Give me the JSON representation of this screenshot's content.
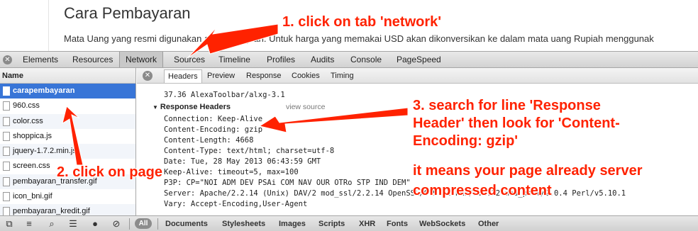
{
  "page": {
    "title": "Cara Pembayaran",
    "paragraph": "Mata Uang yang resmi digunakan adalah Rupiah. Untuk harga yang memakai USD akan dikonversikan ke dalam mata uang Rupiah menggunak"
  },
  "devtools": {
    "tabs": [
      "Elements",
      "Resources",
      "Network",
      "Sources",
      "Timeline",
      "Profiles",
      "Audits",
      "Console",
      "PageSpeed"
    ],
    "active_tab": "Network",
    "left_header": "Name",
    "files": [
      "carapembayaran",
      "960.css",
      "color.css",
      "shoppica.js",
      "jquery-1.7.2.min.js",
      "screen.css",
      "pembayaran_transfer.gif",
      "icon_bni.gif",
      "pembayaran_kredit.gif"
    ],
    "selected_file": "carapembayaran",
    "subtabs": [
      "Headers",
      "Preview",
      "Response",
      "Cookies",
      "Timing"
    ],
    "active_subtab": "Headers",
    "top_line": "37.36 AlexaToolbar/alxg-3.1",
    "response_headers_label": "Response Headers",
    "view_source": "view source",
    "headers": [
      "Connection: Keep-Alive",
      "Content-Encoding: gzip",
      "Content-Length: 4668",
      "Content-Type: text/html; charset=utf-8",
      "Date: Tue, 28 May 2013 06:43:59 GMT",
      "Keep-Alive: timeout=5, max=100",
      "P3P: CP=\"NOI ADM DEV PSAi COM NAV OUR OTRo STP IND DEM\"",
      "Server: Apache/2.2.14 (Unix) DAV/2 mod_ssl/2.2.14 OpenSSL/0.9.8l PHP/5.2.12 mod_perl/2.0.4 Perl/v5.10.1",
      "Vary: Accept-Encoding,User-Agent"
    ],
    "filters": [
      "All",
      "Documents",
      "Stylesheets",
      "Images",
      "Scripts",
      "XHR",
      "Fonts",
      "WebSockets",
      "Other"
    ]
  },
  "annotations": {
    "step1": "1. click on tab 'network'",
    "step2": "2. click on page",
    "step3": [
      "3. search for line 'Response",
      "Header' then look for 'Content-",
      "Encoding: gzip'",
      "it means your page already server",
      "compressed content"
    ],
    "color": "#ff2200"
  }
}
